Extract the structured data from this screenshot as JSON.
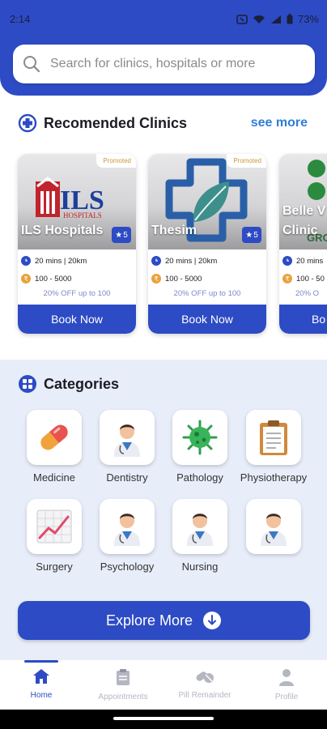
{
  "status_bar": {
    "time": "2:14",
    "battery": "73%"
  },
  "search": {
    "placeholder": "Search for clinics, hospitals or more"
  },
  "recommended": {
    "title": "Recomended Clinics",
    "see_more": "see more",
    "cards": [
      {
        "name": "ILS Hospitals",
        "promoted": "Promoted",
        "rating": "5",
        "distance": "20 mins | 20km",
        "price": "100 - 5000",
        "offer": "20% OFF up to 100",
        "book": "Book Now",
        "logo_text": "ILS",
        "logo_sub": "HOSPITALS"
      },
      {
        "name": "Thesim",
        "promoted": "Promoted",
        "rating": "5",
        "distance": "20 mins | 20km",
        "price": "100 - 5000",
        "offer": "20% OFF up to 100",
        "book": "Book Now"
      },
      {
        "name": "Belle V",
        "name2": "Clinic",
        "logo_sub": "GRO",
        "distance": "20 mins",
        "price": "100 - 50",
        "offer": "20% O",
        "book": "Bo"
      }
    ]
  },
  "categories": {
    "title": "Categories",
    "items": [
      {
        "label": "Medicine",
        "icon": "pill-icon"
      },
      {
        "label": "Dentistry",
        "icon": "doctor-icon"
      },
      {
        "label": "Pathology",
        "icon": "virus-icon"
      },
      {
        "label": "Physiotherapy",
        "icon": "clipboard-icon"
      },
      {
        "label": "Surgery",
        "icon": "chart-icon"
      },
      {
        "label": "Psychology",
        "icon": "doctor-icon"
      },
      {
        "label": "Nursing",
        "icon": "doctor-icon"
      },
      {
        "label": "",
        "icon": "doctor-icon"
      }
    ],
    "explore": "Explore More"
  },
  "nav": {
    "items": [
      {
        "label": "Home",
        "icon": "home-icon",
        "active": true
      },
      {
        "label": "Appointments",
        "icon": "appointments-icon"
      },
      {
        "label": "Pill Remainder",
        "icon": "pill-remainder-icon"
      },
      {
        "label": "Profile",
        "icon": "profile-icon"
      }
    ]
  },
  "colors": {
    "primary": "#2d4bc4",
    "link": "#2f7dd8",
    "section_bg": "#e8edfa"
  }
}
